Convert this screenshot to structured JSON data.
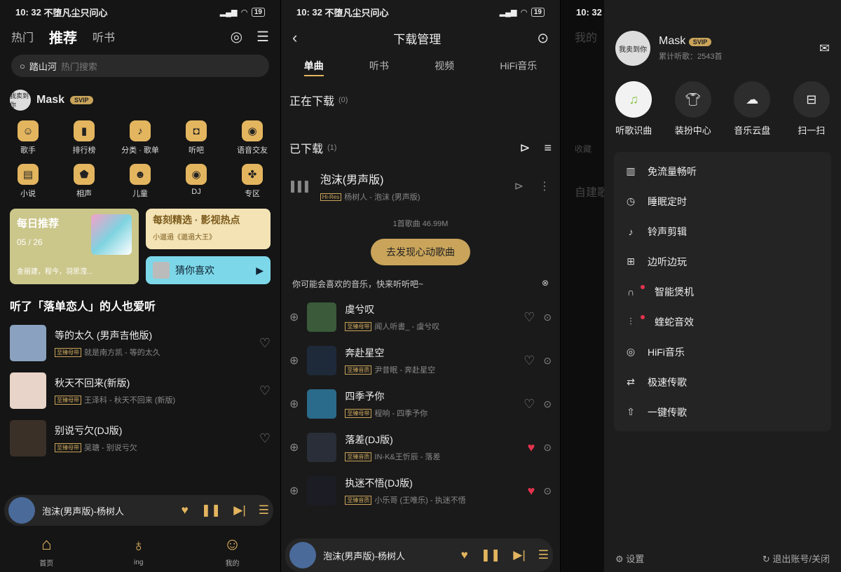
{
  "status": {
    "time": "10: 32",
    "carrier": "不堕凡尘只问心",
    "battery": "19"
  },
  "p1": {
    "tabs": [
      "热门",
      "推荐",
      "听书"
    ],
    "search": {
      "query": "踏山河",
      "placeholder": "热门搜索"
    },
    "user": {
      "name": "Mask",
      "avatar_text": "我卖到你",
      "vip": "SVIP"
    },
    "grid": [
      {
        "label": "歌手",
        "icon": "singer-icon"
      },
      {
        "label": "排行榜",
        "icon": "chart-icon"
      },
      {
        "label": "分类 · 歌单",
        "icon": "playlist-icon"
      },
      {
        "label": "听吧",
        "icon": "radio-icon"
      },
      {
        "label": "语音交友",
        "icon": "voice-icon"
      },
      {
        "label": "小说",
        "icon": "novel-icon"
      },
      {
        "label": "相声",
        "icon": "crosstalk-icon"
      },
      {
        "label": "儿童",
        "icon": "kids-icon"
      },
      {
        "label": "DJ",
        "icon": "dj-icon"
      },
      {
        "label": "专区",
        "icon": "zone-icon"
      }
    ],
    "daily": {
      "title": "每日推荐",
      "date": "05 / 26",
      "sub": "金丽建，程今，羽思滢..."
    },
    "card1": {
      "title": "每刻精选 · 影视热点",
      "sub": "小邋遢《邋遢大王》"
    },
    "card2": {
      "title": "猜你喜欢"
    },
    "section": "听了「落单恋人」的人也爱听",
    "songs": [
      {
        "title": "等的太久 (男声吉他版)",
        "tag": "至臻母带",
        "artist": "就是南方凯 - 等的太久"
      },
      {
        "title": "秋天不回来(新版)",
        "tag": "至臻母带",
        "artist": "王泽科 - 秋天不回来 (新版)"
      },
      {
        "title": "别说亏欠(DJ版)",
        "tag": "至臻母带",
        "artist": "吴瑭 - 别说亏欠"
      }
    ],
    "mini": "泡沫(男声版)-杨树人",
    "bottom": [
      "首页",
      "ing",
      "我的"
    ],
    "svip": "SVIP"
  },
  "p2": {
    "title": "下载管理",
    "tabs": [
      "单曲",
      "听书",
      "视频",
      "HiFi音乐"
    ],
    "downloading": {
      "label": "正在下载",
      "count": "(0)"
    },
    "downloaded": {
      "label": "已下载",
      "count": "(1)"
    },
    "song": {
      "title": "泡沫(男声版)",
      "tag": "Hi-Res",
      "artist": "杨树人 - 泡沫 (男声版)"
    },
    "summary": "1首歌曲 46.99M",
    "discover": "去发现心动歌曲",
    "hint": "你可能会喜欢的音乐，快来听听吧~",
    "recs": [
      {
        "title": "虞兮叹",
        "tag": "至臻母带",
        "artist": "闻人听書_ - 虞兮叹",
        "liked": false
      },
      {
        "title": "奔赴星空",
        "tag": "至臻音质",
        "artist": "尹昔眠 - 奔赴星空",
        "liked": false
      },
      {
        "title": "四季予你",
        "tag": "至臻母带",
        "artist": "程响 - 四季予你",
        "liked": false
      },
      {
        "title": "落差(DJ版)",
        "tag": "至臻音质",
        "artist": "IN-K&王忻辰 - 落差",
        "liked": true
      },
      {
        "title": "执迷不悟(DJ版)",
        "tag": "至臻音质",
        "artist": "小乐哥 (王唯乐) - 执迷不悟",
        "liked": true
      }
    ],
    "mini": "泡沫(男声版)-杨树人"
  },
  "p3": {
    "bg_labels": [
      "我的",
      "收藏",
      "自建歌"
    ],
    "user": {
      "name": "Mask",
      "avatar_text": "我卖到你",
      "listened": "累计听歌：2543首"
    },
    "quick": [
      {
        "label": "听歌识曲",
        "icon": "recognize-icon"
      },
      {
        "label": "装扮中心",
        "icon": "shirt-icon"
      },
      {
        "label": "音乐云盘",
        "icon": "cloud-icon"
      },
      {
        "label": "扫一扫",
        "icon": "scan-icon"
      }
    ],
    "menu": [
      {
        "label": "免流量畅听",
        "icon": "data-icon",
        "dot": false
      },
      {
        "label": "睡眠定时",
        "icon": "timer-icon",
        "dot": false
      },
      {
        "label": "铃声剪辑",
        "icon": "ringtone-icon",
        "dot": false
      },
      {
        "label": "边听边玩",
        "icon": "gamepad-icon",
        "dot": false
      },
      {
        "label": "智能煲机",
        "icon": "headphone-icon",
        "dot": true
      },
      {
        "label": "蝰蛇音效",
        "icon": "equalizer-icon",
        "dot": true
      },
      {
        "label": "HiFi音乐",
        "icon": "hifi-icon",
        "dot": false
      },
      {
        "label": "极速传歌",
        "icon": "transfer-icon",
        "dot": false
      },
      {
        "label": "一键传歌",
        "icon": "upload-icon",
        "dot": false
      }
    ],
    "settings": "设置",
    "logout": "退出账号/关闭"
  }
}
